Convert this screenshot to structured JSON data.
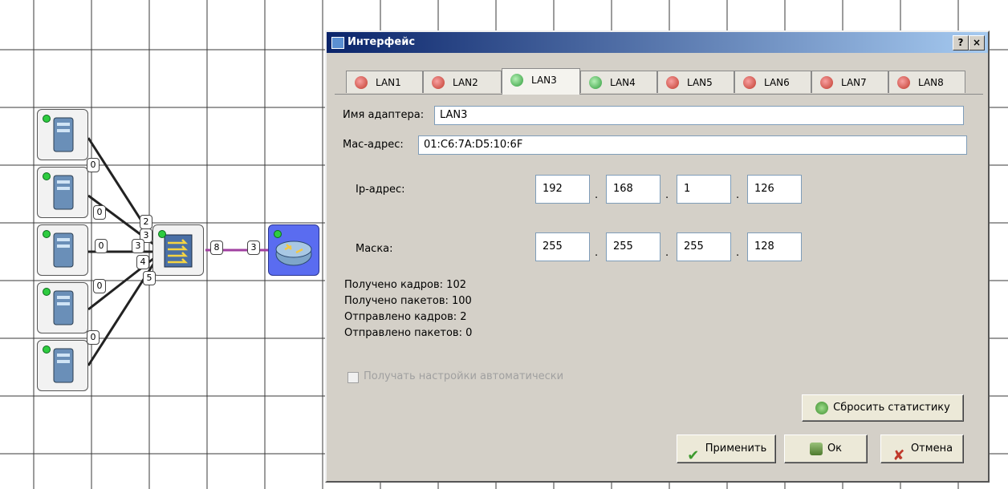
{
  "dialog": {
    "title": "Интерфейс",
    "help_label": "?",
    "close_label": "×",
    "tabs": [
      {
        "label": "LAN1",
        "status": "error"
      },
      {
        "label": "LAN2",
        "status": "error"
      },
      {
        "label": "LAN3",
        "status": "ok"
      },
      {
        "label": "LAN4",
        "status": "ok"
      },
      {
        "label": "LAN5",
        "status": "error"
      },
      {
        "label": "LAN6",
        "status": "error"
      },
      {
        "label": "LAN7",
        "status": "error"
      },
      {
        "label": "LAN8",
        "status": "error"
      }
    ],
    "adapter_name_label": "Имя адаптера:",
    "adapter_name_value": "LAN3",
    "mac_label": "Мас-адрес:",
    "mac_value": "01:C6:7A:D5:10:6F",
    "ip_label": "Ip-адрес:",
    "ip": [
      "192",
      "168",
      "1",
      "126"
    ],
    "mask_label": "Маска:",
    "mask": [
      "255",
      "255",
      "255",
      "128"
    ],
    "octet_separator": ".",
    "stats": [
      "Получено кадров: 102",
      "Получено пакетов: 100",
      "Отправлено кадров: 2",
      "Отправлено пакетов: 0"
    ],
    "auto_settings_label": "Получать настройки автоматически",
    "reset_stats_label": "Сбросить статистику",
    "apply_label": "Применить",
    "ok_label": "Ок",
    "cancel_label": "Отмена"
  },
  "diagram": {
    "port_labels": [
      "0",
      "0",
      "0",
      "0",
      "0",
      "2",
      "3",
      "3",
      "4",
      "5",
      "8",
      "3"
    ]
  },
  "colors": {
    "dialog_bg": "#d4d0c8",
    "titlebar": "#0a246a",
    "status_ok": "#2e9b3a",
    "status_error": "#c0392b",
    "link": "#a040a0"
  },
  "icons": [
    "computer-icon",
    "switch-icon",
    "router-icon",
    "tab-status-icon",
    "reset-icon",
    "apply-check-icon",
    "ok-icon",
    "cancel-x-icon"
  ]
}
